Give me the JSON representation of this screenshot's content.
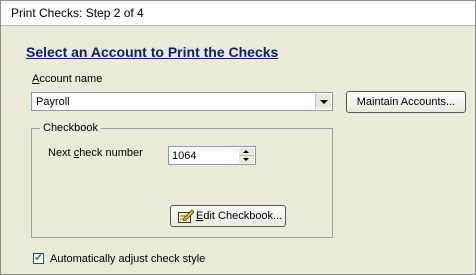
{
  "window": {
    "title": "Print Checks: Step 2 of 4"
  },
  "heading": "Select an Account to Print the Checks",
  "account": {
    "label_first": "A",
    "label_rest": "ccount name",
    "selected": "Payroll",
    "maintain_button": "Maintain Accounts..."
  },
  "checkbook": {
    "group_title": "Checkbook",
    "next_label_a": "Next ",
    "next_label_u": "c",
    "next_label_b": "heck number",
    "next_value": "1064",
    "edit_button_u": "E",
    "edit_button_rest": "dit Checkbook..."
  },
  "options": {
    "auto_adjust_label": "Automatically adjust check style",
    "auto_adjust_checked": true
  }
}
